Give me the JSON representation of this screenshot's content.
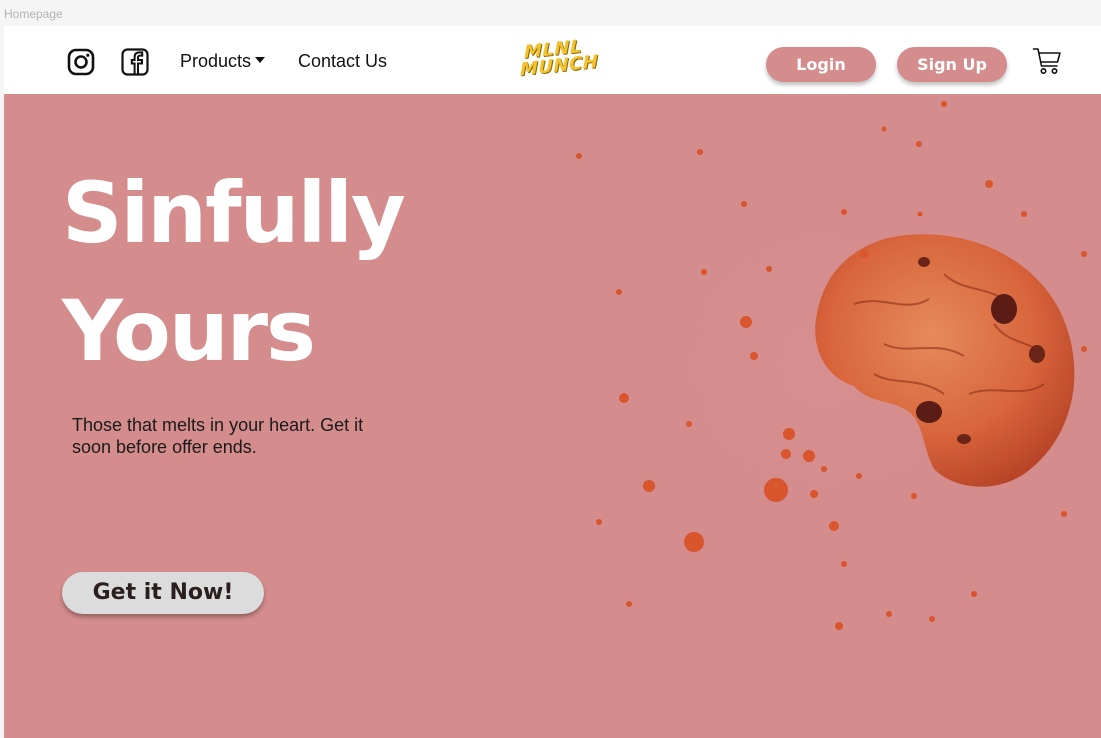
{
  "frame": {
    "label": "Homepage"
  },
  "nav": {
    "instagram_icon": "instagram-icon",
    "facebook_icon": "facebook-icon",
    "products_label": "Products",
    "contact_label": "Contact Us",
    "logo_line1": "MLNL",
    "logo_line2": "MUNCH",
    "login_label": "Login",
    "signup_label": "Sign Up",
    "cart_icon": "cart-icon"
  },
  "hero": {
    "title_line1": "Sinfully",
    "title_line2": "Yours",
    "subtitle": "Those that melts in your heart. Get it soon before offer ends.",
    "cta_label": "Get it Now!",
    "image_icon": "cookie-image"
  },
  "colors": {
    "brand_pink": "#d48c8c",
    "logo_yellow": "#f2c230",
    "cta_gray": "#dcdcdc",
    "cookie_orange": "#e0673f"
  }
}
